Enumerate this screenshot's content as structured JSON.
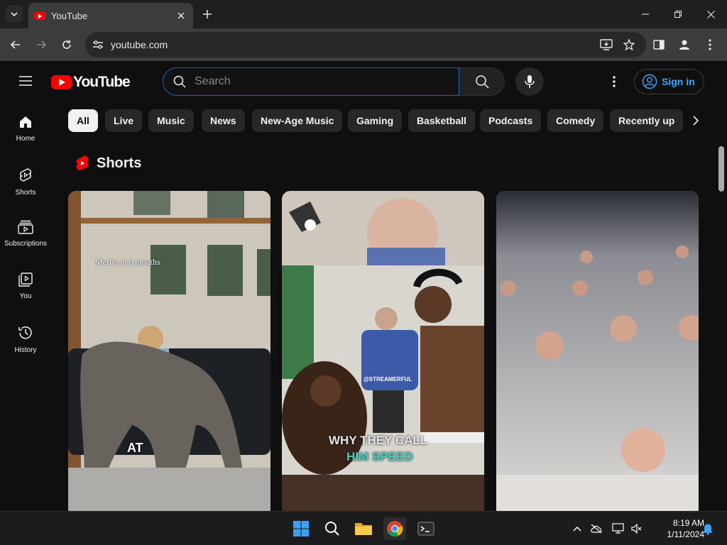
{
  "browser": {
    "tab_title": "YouTube",
    "url": "youtube.com"
  },
  "youtube": {
    "logo_text": "YouTube",
    "search_placeholder": "Search",
    "signin_label": "Sign in",
    "guide": [
      {
        "label": "Home",
        "icon": "home-icon"
      },
      {
        "label": "Shorts",
        "icon": "shorts-icon"
      },
      {
        "label": "Subscriptions",
        "icon": "subscriptions-icon"
      },
      {
        "label": "You",
        "icon": "you-icon"
      },
      {
        "label": "History",
        "icon": "history-icon"
      }
    ],
    "chips": [
      "All",
      "Live",
      "Music",
      "News",
      "New-Age Music",
      "Gaming",
      "Basketball",
      "Podcasts",
      "Comedy",
      "Recently up"
    ],
    "active_chip": "All",
    "shorts_title": "Shorts",
    "shorts": [
      {
        "caption_top": "Merlin at 6 months",
        "caption_bottom": "AT"
      },
      {
        "caption_top": "@STREAMERFUL",
        "caption_line1": "WHY THEY CALL",
        "caption_line2": "HIM SPEED"
      },
      {}
    ]
  },
  "taskbar": {
    "time": "8:19 AM",
    "date": "1/11/2024"
  },
  "colors": {
    "accent_blue": "#3ea6ff",
    "youtube_red": "#ff0000",
    "page_bg": "#0f0f0f"
  }
}
